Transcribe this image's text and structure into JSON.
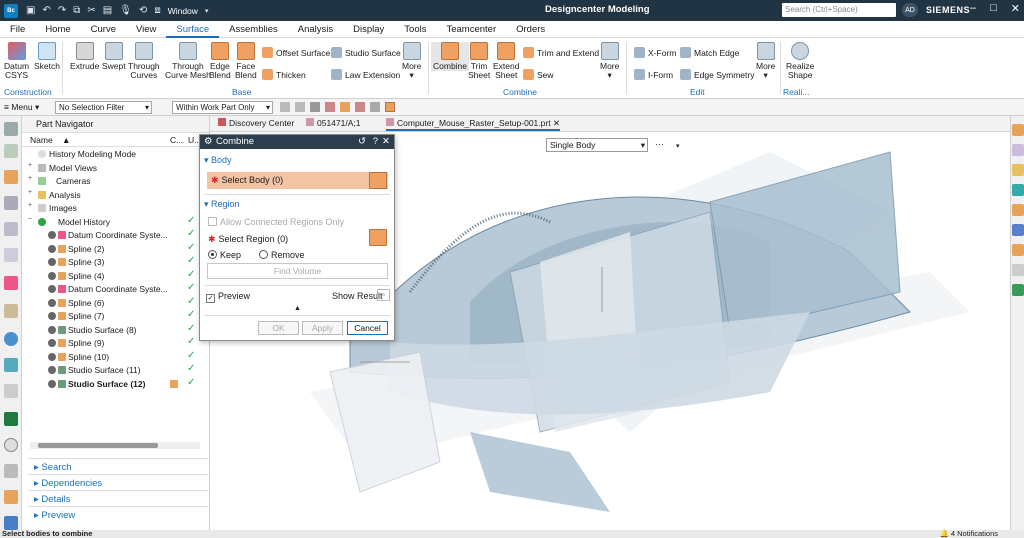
{
  "titlebar": {
    "app_icon": "Bc",
    "window_menu": "Window",
    "title": "Designcenter  Modeling",
    "search_placeholder": "Search (Ctrl+Space)",
    "avatar": "AD",
    "brand": "SIEMENS"
  },
  "menu_tabs": [
    "File",
    "Home",
    "Curve",
    "View",
    "Surface",
    "Assemblies",
    "Analysis",
    "Display",
    "Tools",
    "Teamcenter",
    "Orders"
  ],
  "active_tab": "Surface",
  "ribbon": {
    "datum": "Datum",
    "csys": "CSYS",
    "sketch": "Sketch",
    "extrude": "Extrude",
    "swept": "Swept",
    "through": "Through",
    "curves": "Curves",
    "through2": "Through",
    "curve_mesh": "Curve Mesh",
    "edge": "Edge",
    "blend": "Blend",
    "face": "Face",
    "blend2": "Blend",
    "offset_surface": "Offset Surface",
    "thicken": "Thicken",
    "studio_surface": "Studio Surface",
    "law_extension": "Law Extension",
    "more": "More",
    "combine": "Combine",
    "trim": "Trim",
    "sheet": "Sheet",
    "extend": "Extend",
    "sheet2": "Sheet",
    "trim_and_extend": "Trim and Extend",
    "sew": "Sew",
    "more2": "More",
    "x_form": "X-Form",
    "i_form": "I-Form",
    "match_edge": "Match Edge",
    "edge_symmetry": "Edge Symmetry",
    "more3": "More",
    "realize": "Realize",
    "shape": "Shape",
    "group_construction": "Construction",
    "group_base": "Base",
    "group_combine": "Combine",
    "group_edit": "Edit",
    "group_realize": "Reali..."
  },
  "toolbar2": {
    "menu": "Menu",
    "filter": "No Selection Filter",
    "scope": "Within Work Part Only"
  },
  "navigator": {
    "title": "Part Navigator",
    "col_name": "Name",
    "col_c": "C...",
    "col_u": "U...",
    "items": [
      {
        "label": "History Modeling Mode",
        "check": ""
      },
      {
        "label": "Model Views",
        "check": ""
      },
      {
        "label": "Cameras",
        "check": ""
      },
      {
        "label": "Analysis",
        "check": ""
      },
      {
        "label": "Images",
        "check": ""
      },
      {
        "label": "Model History",
        "check": "✓"
      },
      {
        "label": "Datum Coordinate Syste...",
        "check": "✓"
      },
      {
        "label": "Spline (2)",
        "check": "✓"
      },
      {
        "label": "Spline (3)",
        "check": "✓"
      },
      {
        "label": "Spline (4)",
        "check": "✓"
      },
      {
        "label": "Datum Coordinate Syste...",
        "check": "✓"
      },
      {
        "label": "Spline (6)",
        "check": "✓"
      },
      {
        "label": "Spline (7)",
        "check": "✓"
      },
      {
        "label": "Studio Surface (8)",
        "check": "✓"
      },
      {
        "label": "Spline (9)",
        "check": "✓"
      },
      {
        "label": "Spline (10)",
        "check": "✓"
      },
      {
        "label": "Studio Surface (11)",
        "check": "✓"
      },
      {
        "label": "Studio Surface (12)",
        "check": "✓"
      }
    ],
    "sections": [
      "Search",
      "Dependencies",
      "Details",
      "Preview"
    ]
  },
  "doc_tabs": [
    "Discovery Center",
    "051471/A;1",
    "Computer_Mouse_Raster_Setup-001.prt"
  ],
  "viewport": {
    "body_select": "Single Body"
  },
  "dialog": {
    "title": "Combine",
    "section_body": "Body",
    "select_body": "Select Body (0)",
    "section_region": "Region",
    "allow_connected": "Allow Connected Regions Only",
    "select_region": "Select Region (0)",
    "keep": "Keep",
    "remove": "Remove",
    "find_volume": "Find Volume",
    "preview": "Preview",
    "show_result": "Show Result",
    "ok": "OK",
    "apply": "Apply",
    "cancel": "Cancel"
  },
  "status": {
    "left": "Select bodies to combine",
    "right": "4 Notifications"
  }
}
